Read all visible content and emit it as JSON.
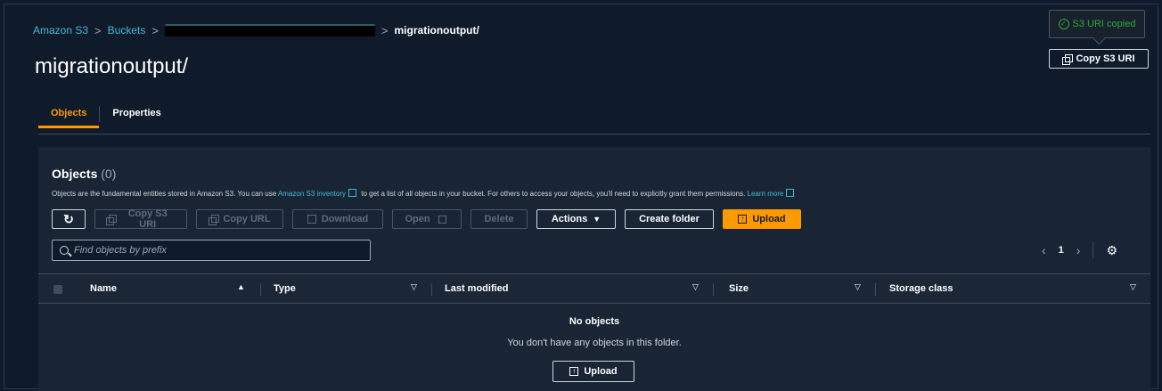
{
  "breadcrumb": {
    "root": "Amazon S3",
    "buckets": "Buckets",
    "current": "migrationoutput/"
  },
  "page_title": "migrationoutput/",
  "popover": {
    "copied_text": "S3 URI copied"
  },
  "header_actions": {
    "copy_s3_uri": "Copy S3 URI"
  },
  "tabs": [
    {
      "label": "Objects",
      "active": true
    },
    {
      "label": "Properties",
      "active": false
    }
  ],
  "objects_panel": {
    "heading": "Objects",
    "count": "(0)",
    "description_part1": "Objects are the fundamental entities stored in Amazon S3. You can use",
    "inventory_link": "Amazon S3 inventory",
    "description_part2": "to get a list of all objects in your bucket. For others to access your objects, you'll need to explicitly grant them permissions.",
    "learn_more": "Learn more",
    "toolbar": {
      "refresh": "↻",
      "copy_s3_uri": "Copy S3 URI",
      "copy_url": "Copy URL",
      "download": "Download",
      "open": "Open",
      "delete": "Delete",
      "actions": "Actions",
      "create_folder": "Create folder",
      "upload": "Upload"
    },
    "search": {
      "placeholder": "Find objects by prefix",
      "value": ""
    },
    "pagination": {
      "current_page": "1",
      "prev": "‹",
      "next": "›"
    },
    "columns": [
      "Name",
      "Type",
      "Last modified",
      "Size",
      "Storage class"
    ],
    "empty_state": {
      "title": "No objects",
      "message": "You don't have any objects in this folder.",
      "upload": "Upload"
    }
  },
  "colors": {
    "accent": "#ff9900",
    "link": "#44b9d6",
    "success": "#29ad32",
    "background": "#0f1b2a",
    "panel": "#192534"
  }
}
